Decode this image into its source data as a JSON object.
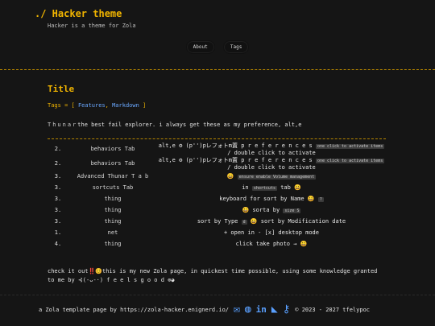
{
  "header": {
    "title": "./ Hacker theme",
    "tagline": "Hacker is a theme for Zola",
    "nav": [
      "About",
      "Tags"
    ]
  },
  "post": {
    "title": "Title",
    "tags_prefix": "Tags = [",
    "tags": [
      "Features",
      "Markdown"
    ],
    "tags_suffix": "]",
    "intro_spaced": "Thunar",
    "intro_text": "the best fail explorer. i always get these as my preference, alt,e"
  },
  "table": {
    "rows": [
      {
        "num": "2.",
        "img": "behaviors Tab",
        "desc_main": "alt,e ⚙ (p'')pレフォトm置 p r e f e r e n c e s",
        "kbd1": "one click to activate items",
        "kbd2": "/ double click to activate"
      },
      {
        "num": "2.",
        "img": "behaviors Tab",
        "desc_main": "alt,e ⚙ (p'')pレフォトm置 p r e f e r e n c e s",
        "kbd1": "one click to activate items",
        "kbd2": "/ double click to activate"
      },
      {
        "num": "3.",
        "img": "Advanced Thunar T a b",
        "desc_main": "😀",
        "kbd1": "ensure enable Volume management",
        "kbd2": ""
      },
      {
        "num": "3.",
        "img": "sortcuts Tab",
        "desc_main": "in",
        "kbd1": "shortcuts",
        "kbd2": "tab 😀"
      },
      {
        "num": "3.",
        "img": "thing",
        "desc_main": "keyboard for sort by Name 😀",
        "kbd1": "?",
        "kbd2": ""
      },
      {
        "num": "3.",
        "img": "thing",
        "desc_main": "😀 sorta by",
        "kbd1": "size S",
        "kbd2": ""
      },
      {
        "num": "3.",
        "img": "thing",
        "desc_main": "sort by Type",
        "kbd1": "d",
        "kbd2": "😀 sort by Modification date"
      },
      {
        "num": "1.",
        "img": "net",
        "desc_main": "+ open in - [x] desktop mode",
        "kbd1": "",
        "kbd2": ""
      },
      {
        "num": "4.",
        "img": "thing",
        "desc_main": "click take photo → 😀",
        "kbd1": "",
        "kbd2": ""
      }
    ]
  },
  "closing": {
    "line": "check it out‼️😊this is my new Zola page, in quickest time possible, using some knowledge granted to me by ⊰(-ᴗ-·) f e e l s g o o d ⊚◕"
  },
  "footer": {
    "text": "a Zola template page by https://zola-hacker.enignerd.io/",
    "icons": [
      "mail-icon",
      "github-icon",
      "linkedin-icon",
      "rss-icon",
      "key-icon"
    ],
    "copyright": "© 2023 - 2027 tfelypoc"
  }
}
